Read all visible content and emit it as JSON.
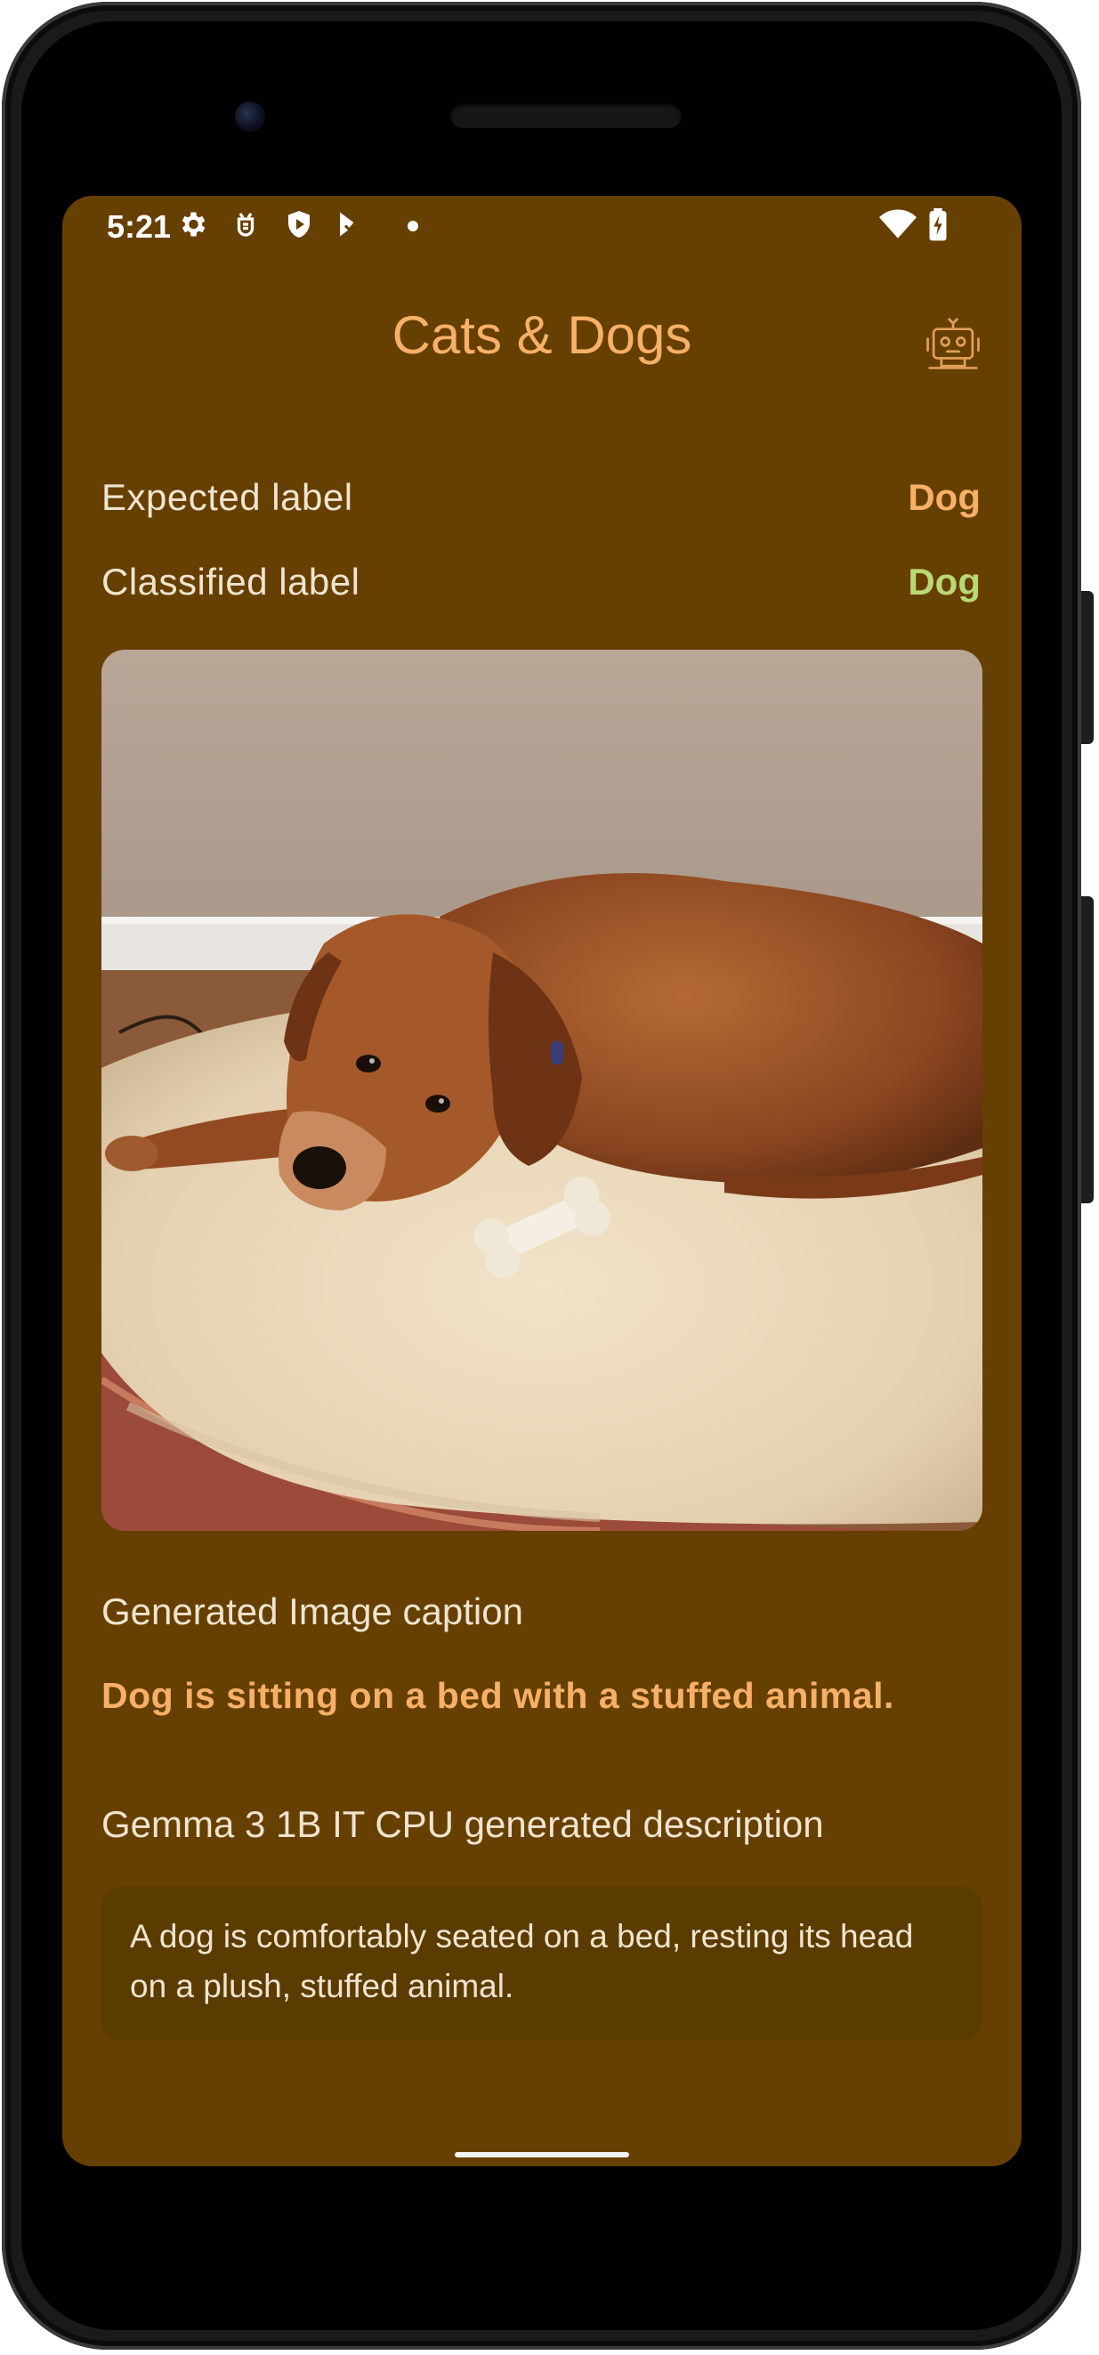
{
  "status_bar": {
    "time": "5:21",
    "left_icons": [
      "gear-icon",
      "android-debug-icon",
      "shield-icon",
      "play-store-icon",
      "dot-icon"
    ],
    "right_icons": [
      "wifi-icon",
      "battery-charging-icon"
    ]
  },
  "app_bar": {
    "title": "Cats & Dogs",
    "action_icon": "robot-icon"
  },
  "results": {
    "expected_label": "Expected label",
    "expected_value": "Dog",
    "classified_label": "Classified label",
    "classified_value": "Dog"
  },
  "image": {
    "subject": "dog-on-bed-photo"
  },
  "caption": {
    "header": "Generated Image caption",
    "text": "Dog is sitting on a bed with a stuffed animal."
  },
  "description": {
    "header": "Gemma 3 1B IT CPU generated description",
    "text": "A dog is comfortably seated on a bed, resting its head on a plush, stuffed animal."
  },
  "colors": {
    "background": "#663f02",
    "accent": "#f6b067",
    "success": "#bad874",
    "text": "#f0e4cf",
    "card": "#5a3c00"
  }
}
